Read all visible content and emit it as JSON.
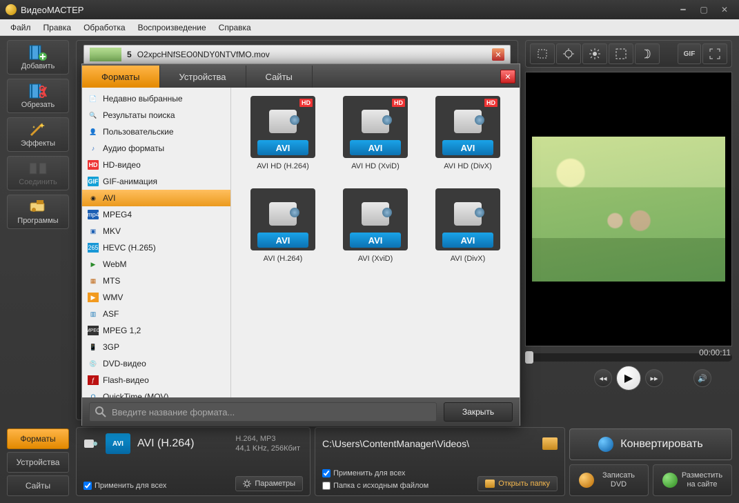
{
  "app": {
    "title": "ВидеоМАСТЕР"
  },
  "menu": [
    "Файл",
    "Правка",
    "Обработка",
    "Воспроизведение",
    "Справка"
  ],
  "sidebar": {
    "items": [
      {
        "label": "Добавить"
      },
      {
        "label": "Обрезать"
      },
      {
        "label": "Эффекты"
      },
      {
        "label": "Соединить"
      },
      {
        "label": "Программы"
      }
    ]
  },
  "left_tabs": [
    "Форматы",
    "Устройства",
    "Сайты"
  ],
  "bottom": {
    "format_name": "AVI (H.264)",
    "format_icon_label": "AVI",
    "codec_line1": "H.264, MP3",
    "codec_line2": "44,1 KHz,  256Кбит",
    "apply_all": "Применить для всех",
    "params_btn": "Параметры",
    "out_path": "C:\\Users\\ContentManager\\Videos\\",
    "apply_all2": "Применить для всех",
    "same_folder": "Папка с исходным файлом",
    "open_folder": "Открыть папку"
  },
  "right_buttons": {
    "convert": "Конвертировать",
    "dvd": "Записать DVD",
    "web": "Разместить на сайте"
  },
  "preview": {
    "time": "00:00:11",
    "gif_label": "GIF"
  },
  "list": {
    "row1_num": "5",
    "row1_name": "O2xpcHNfSEO0NDY0NTVfMO.mov"
  },
  "dialog": {
    "tabs": [
      "Форматы",
      "Устройства",
      "Сайты"
    ],
    "categories": [
      "Недавно выбранные",
      "Результаты поиска",
      "Пользовательские",
      "Аудио форматы",
      "HD-видео",
      "GIF-анимация",
      "AVI",
      "MPEG4",
      "MKV",
      "HEVC (H.265)",
      "WebM",
      "MTS",
      "WMV",
      "ASF",
      "MPEG 1,2",
      "3GP",
      "DVD-видео",
      "Flash-видео",
      "QuickTime (MOV)"
    ],
    "presets": [
      {
        "badge": "AVI",
        "hd": true,
        "label": "AVI HD (H.264)"
      },
      {
        "badge": "AVI",
        "hd": true,
        "label": "AVI HD (XviD)"
      },
      {
        "badge": "AVI",
        "hd": true,
        "label": "AVI HD (DivX)"
      },
      {
        "badge": "AVI",
        "hd": false,
        "label": "AVI (H.264)"
      },
      {
        "badge": "AVI",
        "hd": false,
        "label": "AVI (XviD)"
      },
      {
        "badge": "AVI",
        "hd": false,
        "label": "AVI (DivX)"
      }
    ],
    "search_placeholder": "Введите название формата...",
    "close_btn": "Закрыть"
  }
}
